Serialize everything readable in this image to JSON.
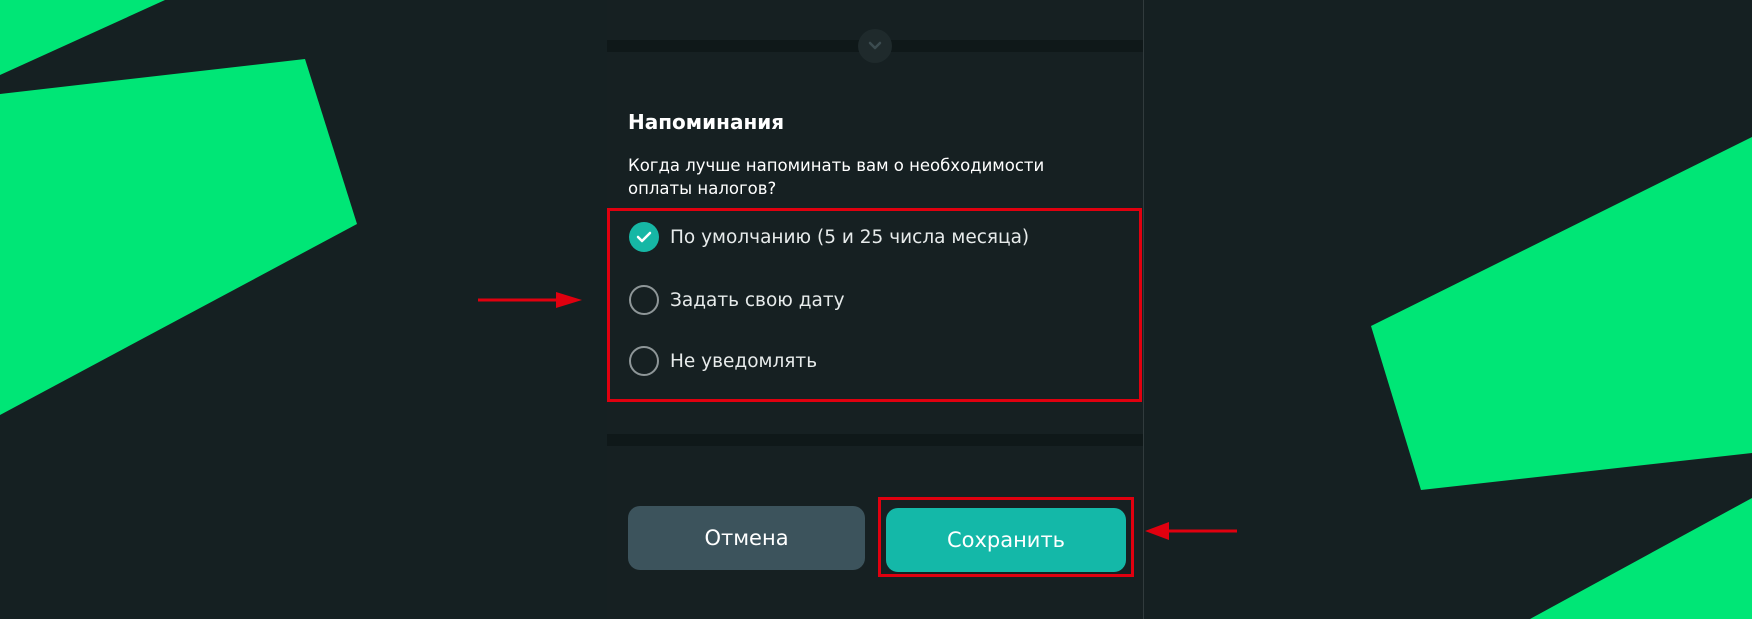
{
  "reminders": {
    "title": "Напоминания",
    "question": "Когда лучше напоминать вам о необходимости оплаты налогов?",
    "options": [
      {
        "label": "По умолчанию (5 и 25 числа месяца)",
        "checked": true
      },
      {
        "label": "Задать свою дату",
        "checked": false
      },
      {
        "label": "Не уведомлять",
        "checked": false
      }
    ]
  },
  "actions": {
    "cancel_label": "Отмена",
    "save_label": "Сохранить"
  },
  "colors": {
    "background": "#152022",
    "accent_green": "#00e676",
    "teal": "#14b8a8",
    "cancel_bg": "#3c535c",
    "annotation_red": "#e0000f"
  },
  "icons": {
    "collapse": "chevron-down-icon",
    "selected": "check-icon"
  }
}
